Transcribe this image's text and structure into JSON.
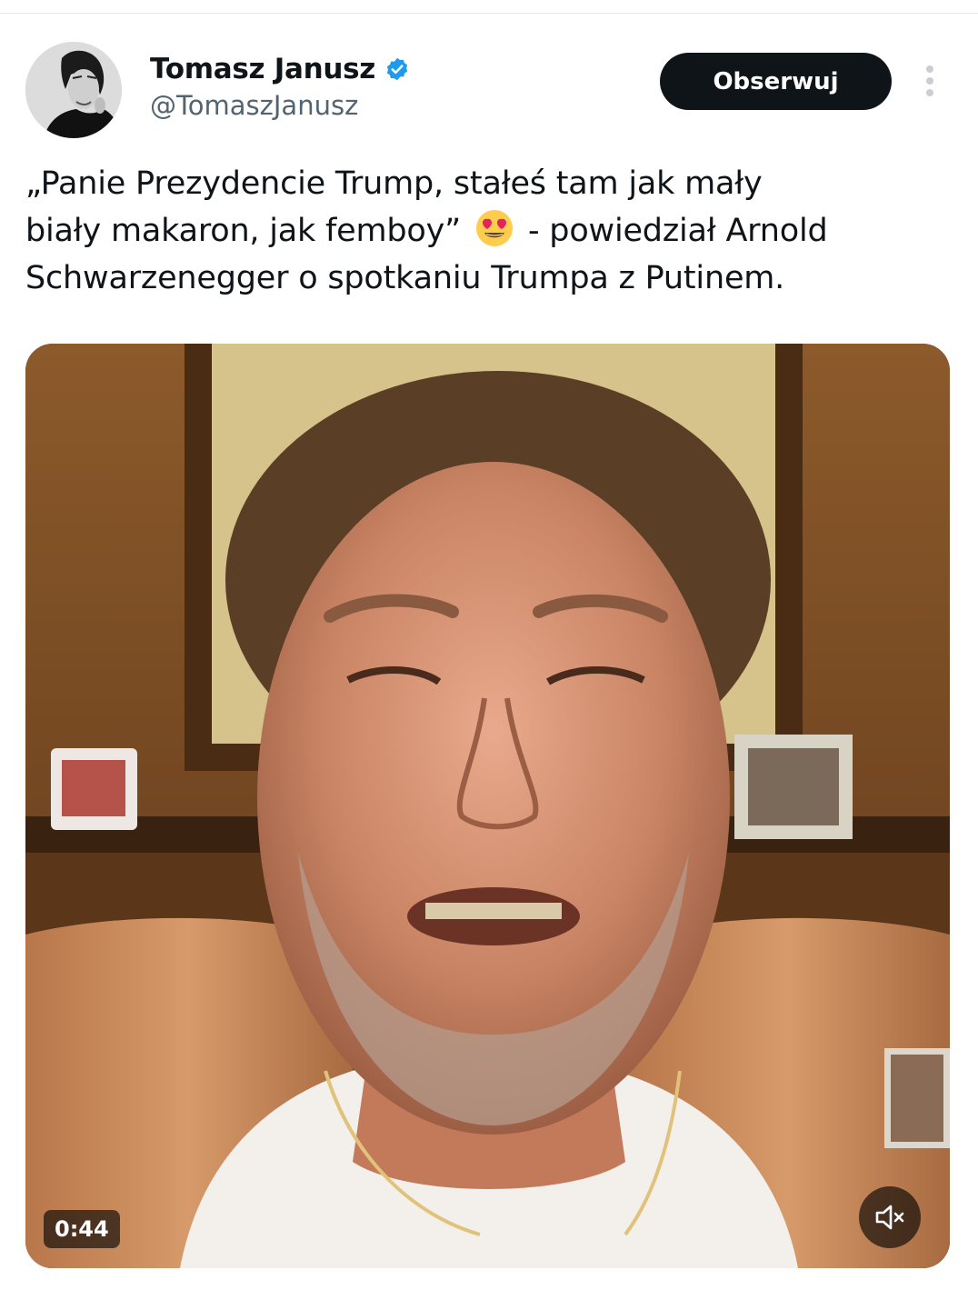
{
  "author": {
    "display_name": "Tomasz Janusz",
    "handle": "@TomaszJanusz",
    "avatar_icon": "profile-photo",
    "verified_icon": "verified-badge-icon",
    "verified_color": "#1d9bf0"
  },
  "actions": {
    "follow_label": "Obserwuj",
    "more_icon": "more-vertical-icon"
  },
  "tweet": {
    "line1": "„Panie Prezydencie Trump, stałeś tam jak mały",
    "line2_before_emoji": "biały makaron, jak femboy”",
    "line2_emoji": "smiling-face-with-heart-eyes-icon",
    "line2_after_emoji": " - powiedział Arnold",
    "line3": "Schwarzenegger o spotkaniu Trumpa z Putinem."
  },
  "media": {
    "type": "video",
    "duration": "0:44",
    "mute_icon": "volume-muted-icon"
  },
  "colors": {
    "text_primary": "#0f1419",
    "text_secondary": "#536471",
    "button_dark": "#0f1419"
  }
}
